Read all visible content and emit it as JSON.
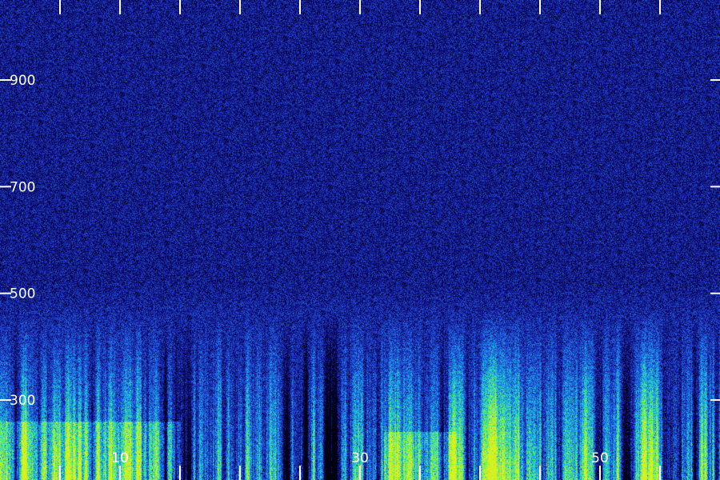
{
  "chart_data": {
    "type": "heatmap",
    "title": "",
    "xlabel": "",
    "ylabel": "",
    "xlim": [
      0,
      60
    ],
    "ylim": [
      150,
      1050
    ],
    "x_ticks": [
      5,
      10,
      15,
      20,
      25,
      30,
      35,
      40,
      45,
      50,
      55
    ],
    "x_tick_labels": [
      {
        "value": 10,
        "label": "10"
      },
      {
        "value": 30,
        "label": "30"
      },
      {
        "value": 50,
        "label": "50"
      }
    ],
    "y_ticks": [
      300,
      500,
      700,
      900
    ],
    "y_tick_labels": [
      {
        "value": 900,
        "label": "900"
      },
      {
        "value": 700,
        "label": "700"
      },
      {
        "value": 500,
        "label": "500"
      },
      {
        "value": 300,
        "label": "300"
      }
    ],
    "grid": false,
    "colormap": [
      "#000010",
      "#0a0a6e",
      "#1e2ab4",
      "#1f5fe0",
      "#18a8e8",
      "#2de0b0",
      "#7cf050",
      "#d8f020"
    ],
    "energy_bands": [
      {
        "y_range": [
          150,
          350
        ],
        "intensity": "high",
        "color": "#2de0b0"
      },
      {
        "y_range": [
          350,
          500
        ],
        "intensity": "medium",
        "color": "#18a8e8"
      },
      {
        "y_range": [
          500,
          1050
        ],
        "intensity": "low",
        "color": "#1e2ab4"
      }
    ],
    "bright_regions": [
      {
        "x_range": [
          0,
          15
        ],
        "y_range": [
          150,
          260
        ],
        "color": "#7cf050"
      },
      {
        "x_range": [
          32,
          38
        ],
        "y_range": [
          150,
          240
        ],
        "color": "#2de0b0"
      }
    ]
  }
}
